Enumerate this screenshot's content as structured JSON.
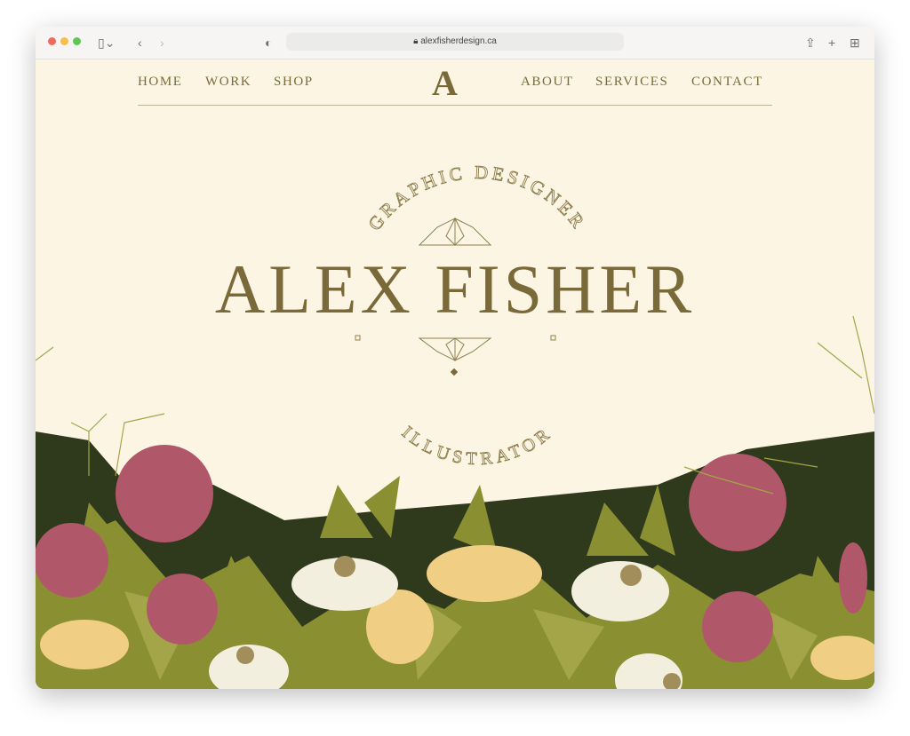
{
  "browser": {
    "url": "alexfisherdesign.ca"
  },
  "nav": {
    "left": [
      "HOME",
      "WORK",
      "SHOP"
    ],
    "right": [
      "ABOUT",
      "SERVICES",
      "CONTACT"
    ],
    "logo": "A"
  },
  "hero": {
    "top_arc": "GRAPHIC DESIGNER",
    "title": "ALEX FISHER",
    "bottom_arc": "ILLUSTRATOR"
  },
  "colors": {
    "background": "#fdf5e3",
    "brand": "#7a6a3a",
    "pink": "#b0586a",
    "leaf": "#8a8f32",
    "dark_leaf": "#2f3a1c"
  }
}
